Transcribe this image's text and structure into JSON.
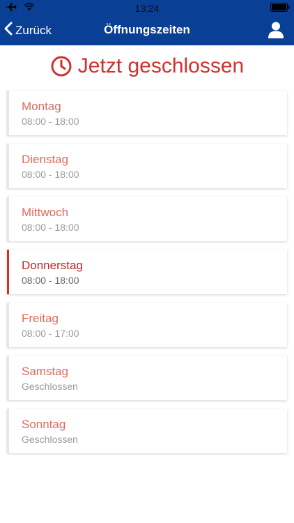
{
  "statusbar": {
    "time": "13:24"
  },
  "navbar": {
    "back_label": "Zurück",
    "title": "Öffnungszeiten"
  },
  "status_banner": {
    "text": "Jetzt geschlossen",
    "color": "#d0312d"
  },
  "colors": {
    "header_bg": "#0a3f96",
    "accent": "#d0312d",
    "day_name": "#e06a5e",
    "hours_text": "#9a9a9a"
  },
  "days": [
    {
      "name": "Montag",
      "hours": "08:00 - 18:00",
      "active": false
    },
    {
      "name": "Dienstag",
      "hours": "08:00 - 18:00",
      "active": false
    },
    {
      "name": "Mittwoch",
      "hours": "08:00 - 18:00",
      "active": false
    },
    {
      "name": "Donnerstag",
      "hours": "08:00 - 18:00",
      "active": true
    },
    {
      "name": "Freitag",
      "hours": "08:00 - 17:00",
      "active": false
    },
    {
      "name": "Samstag",
      "hours": "Geschlossen",
      "active": false
    },
    {
      "name": "Sonntag",
      "hours": "Geschlossen",
      "active": false
    }
  ]
}
